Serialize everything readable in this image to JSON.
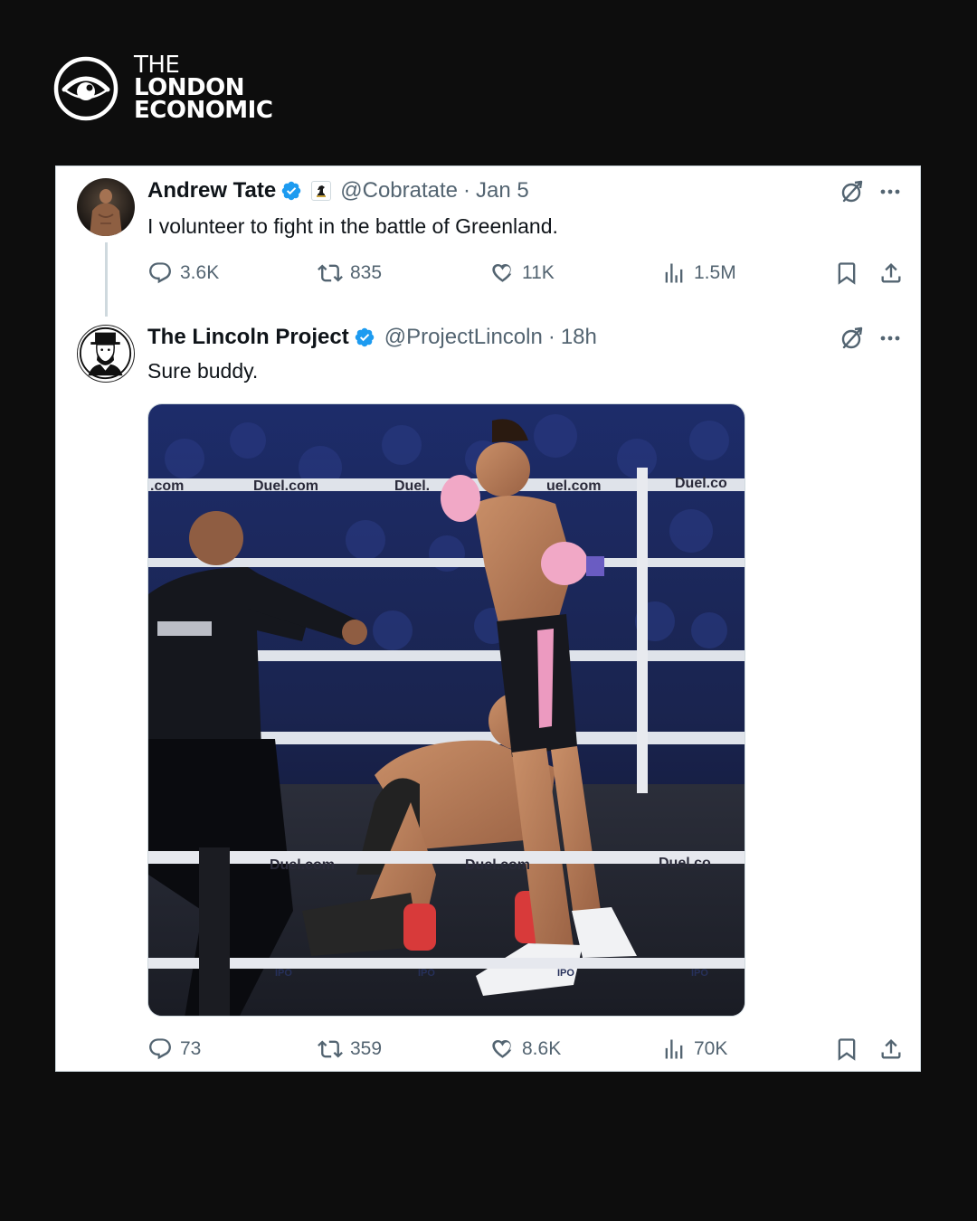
{
  "brand": {
    "line1": "THE",
    "line2": "LONDON",
    "line3": "ECONOMIC"
  },
  "tweet1": {
    "name": "Andrew Tate",
    "handle": "@Cobratate",
    "separator": "·",
    "time": "Jan 5",
    "text": "I volunteer to fight in the battle of Greenland.",
    "replies": "3.6K",
    "reposts": "835",
    "likes": "11K",
    "views": "1.5M"
  },
  "tweet2": {
    "name": "The Lincoln Project",
    "handle": "@ProjectLincoln",
    "separator": "·",
    "time": "18h",
    "text": "Sure buddy.",
    "replies": "73",
    "reposts": "359",
    "likes": "8.6K",
    "views": "70K"
  },
  "media": {
    "ring_banner": "Duel.com",
    "ring_banner_partial_left": ".com",
    "ring_banner_partial_mid": "Duel.",
    "ring_banner_partial_right": "uel.com",
    "ring_banner_cut": "Duel.co",
    "ring_banner_cut_lower": "Duel.co",
    "rope_sponsor": "IPO"
  },
  "colors": {
    "verified": "#1d9bf0",
    "text": "#0f1419",
    "muted": "#536471"
  }
}
